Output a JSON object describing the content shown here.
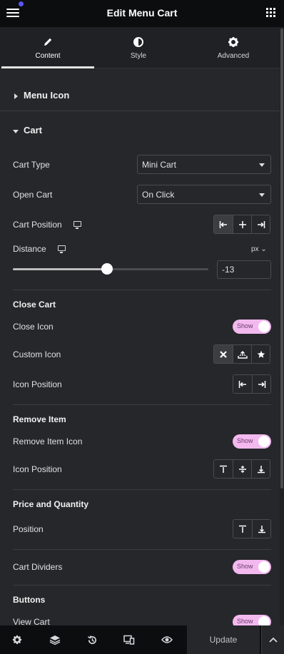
{
  "header": {
    "title": "Edit Menu Cart"
  },
  "tabs": [
    {
      "label": "Content",
      "icon": "pencil-icon"
    },
    {
      "label": "Style",
      "icon": "half-circle-icon"
    },
    {
      "label": "Advanced",
      "icon": "gear-icon"
    }
  ],
  "sections": {
    "menu_icon": "Menu Icon",
    "cart": "Cart"
  },
  "cart": {
    "cart_type_label": "Cart Type",
    "cart_type_value": "Mini Cart",
    "open_cart_label": "Open Cart",
    "open_cart_value": "On Click",
    "cart_position_label": "Cart Position",
    "distance_label": "Distance",
    "distance_unit": "px",
    "distance_value": "-13",
    "distance_slider_fraction": 0.48
  },
  "close_cart": {
    "heading": "Close Cart",
    "close_icon_label": "Close Icon",
    "close_icon_toggle": "Show",
    "custom_icon_label": "Custom Icon",
    "icon_position_label": "Icon Position"
  },
  "remove_item": {
    "heading": "Remove Item",
    "remove_item_icon_label": "Remove Item Icon",
    "remove_item_icon_toggle": "Show",
    "icon_position_label": "Icon Position"
  },
  "price_quantity": {
    "heading": "Price and Quantity",
    "position_label": "Position"
  },
  "cart_dividers": {
    "label": "Cart Dividers",
    "toggle": "Show"
  },
  "buttons": {
    "heading": "Buttons",
    "view_cart_label": "View Cart",
    "view_cart_toggle": "Show"
  },
  "footer": {
    "update_label": "Update"
  },
  "colors": {
    "accent_dot": "#5956ff",
    "toggle_on": "#f3b9ef"
  }
}
